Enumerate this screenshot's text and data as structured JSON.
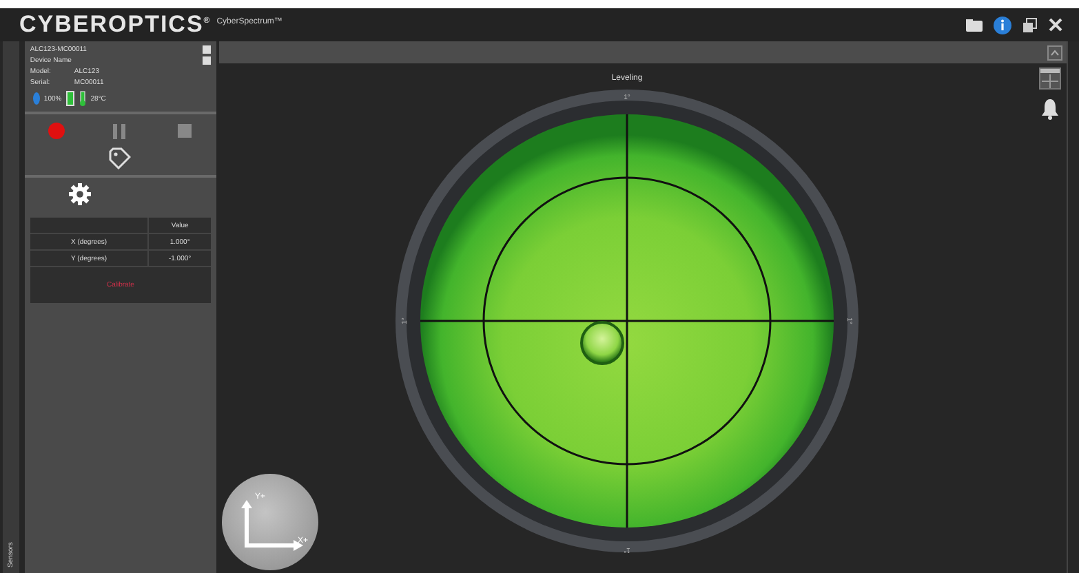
{
  "window": {
    "brand": "CYBEROPTICS",
    "brand_mark": "®",
    "product": "CyberSpectrum™"
  },
  "side_tab": {
    "label": "Sensors"
  },
  "device": {
    "id": "ALC123-MC00011",
    "name": "Device Name",
    "model_label": "Model:",
    "model": "ALC123",
    "serial_label": "Serial:",
    "serial": "MC00011",
    "battery": "100%",
    "temperature": "28°C"
  },
  "recording": {
    "on": true
  },
  "table": {
    "columns": [
      "",
      "Value"
    ],
    "rows": [
      {
        "label": "X (degrees)",
        "value": "1.000°"
      },
      {
        "label": "Y (degrees)",
        "value": "-1.000°"
      }
    ],
    "action": "Calibrate"
  },
  "leveling": {
    "title": "Leveling",
    "marks": [
      "1°",
      "1°",
      "1°",
      "1°"
    ]
  },
  "axes": {
    "y": "Y+",
    "x": "X+"
  }
}
